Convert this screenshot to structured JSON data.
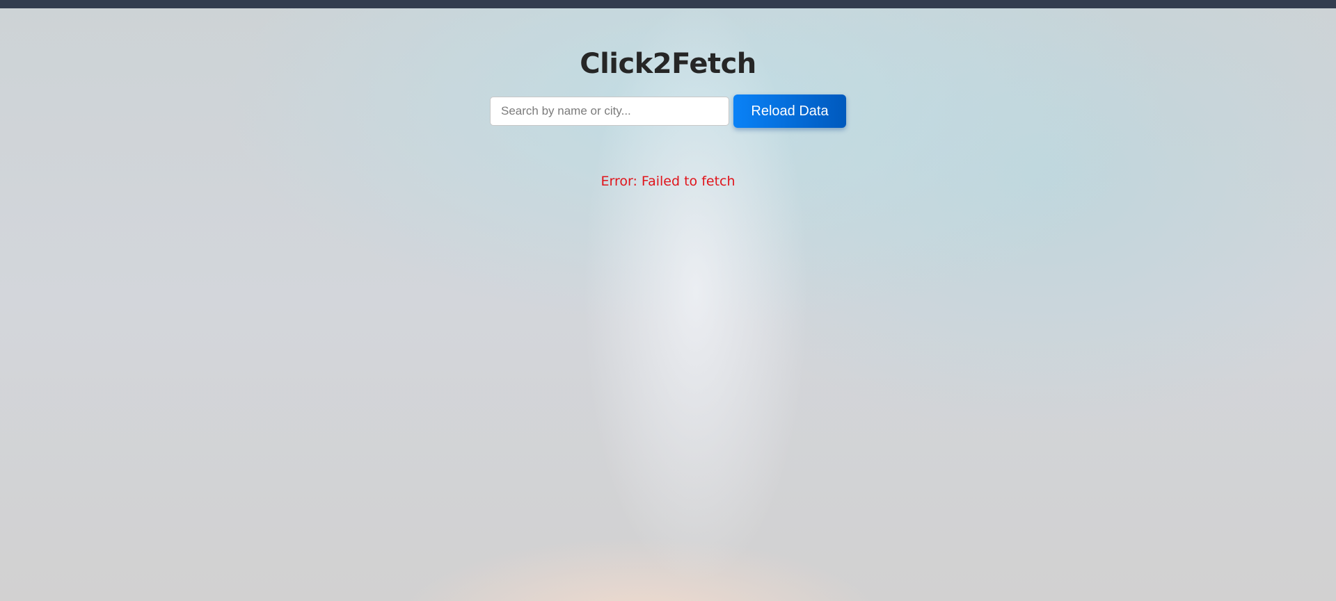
{
  "header": {
    "title": "Click2Fetch"
  },
  "search": {
    "placeholder": "Search by name or city...",
    "value": ""
  },
  "toolbar": {
    "reload_label": "Reload Data"
  },
  "status": {
    "error": "Error: Failed to fetch"
  },
  "colors": {
    "topbar": "#333d4f",
    "button_gradient_start": "#0a82f7",
    "button_gradient_end": "#0059bd",
    "error_text": "#e0141b",
    "title_text": "#262626"
  }
}
